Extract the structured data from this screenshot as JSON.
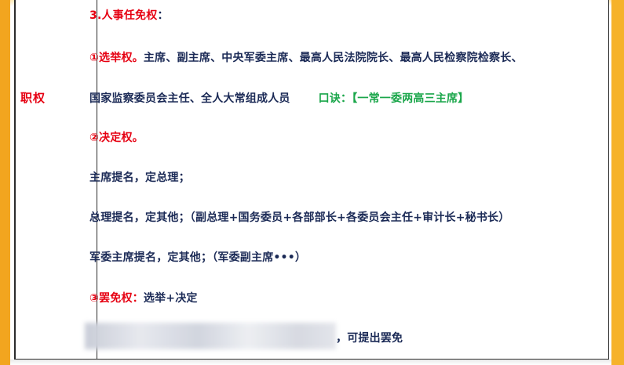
{
  "row_label": "职权",
  "heading": "3.人事任免权",
  "heading_colon": "：",
  "election": {
    "title": "①选举权。",
    "line1": "主席、副主席、中央军委主席、最高人民法院院长、最高人民检察院检察长、",
    "line2": "国家监察委员会主任、全人大常组成人员",
    "mnemonic": "口诀：【一常一委两高三主席】"
  },
  "decision": {
    "title": "②决定权。",
    "line1": "主席提名，定总理；",
    "line2": "总理提名，定其他；（副总理+国务委员+各部部长+各委员会主任+审计长+秘书长）",
    "line3": "军委主席提名，定其他；（军委副主席•••）"
  },
  "removal": {
    "title": "③罢免权：",
    "text": "选举+决定"
  },
  "last_line_visible": "，可提出罢免",
  "colors": {
    "accent_red": "#e60012",
    "text_navy": "#1b2a56",
    "mnemonic_green": "#1aa64a",
    "frame_orange": "#f2a51f"
  }
}
